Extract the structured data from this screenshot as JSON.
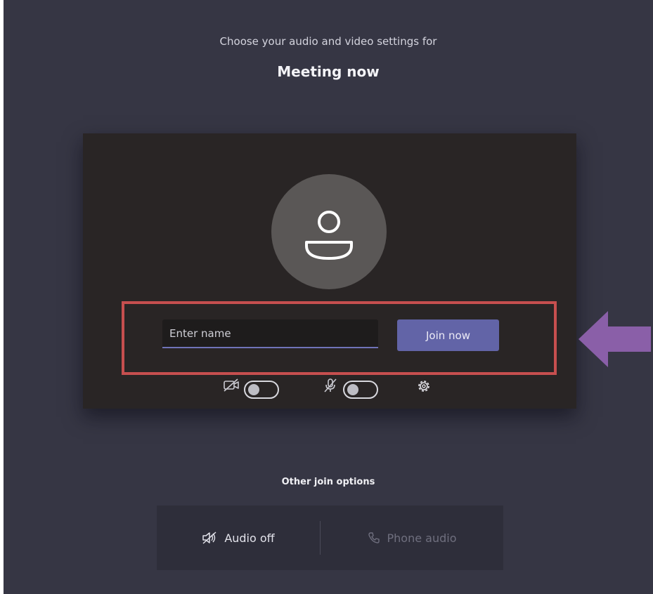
{
  "header": {
    "subtitle": "Choose your audio and video settings for",
    "meeting_title": "Meeting now"
  },
  "join_form": {
    "name_placeholder": "Enter name",
    "name_value": "",
    "join_label": "Join now"
  },
  "device_controls": {
    "camera": {
      "icon": "camera-off-icon",
      "state": "off"
    },
    "microphone": {
      "icon": "mic-off-icon",
      "state": "off"
    },
    "settings": {
      "icon": "gear-icon"
    }
  },
  "other_options": {
    "label": "Other join options",
    "audio_off_label": "Audio off",
    "phone_audio_label": "Phone audio"
  },
  "colors": {
    "background": "#363644",
    "card": "#292525",
    "accent": "#6264a7",
    "highlight_border": "#c64f4f",
    "arrow": "#8a5fa8"
  }
}
